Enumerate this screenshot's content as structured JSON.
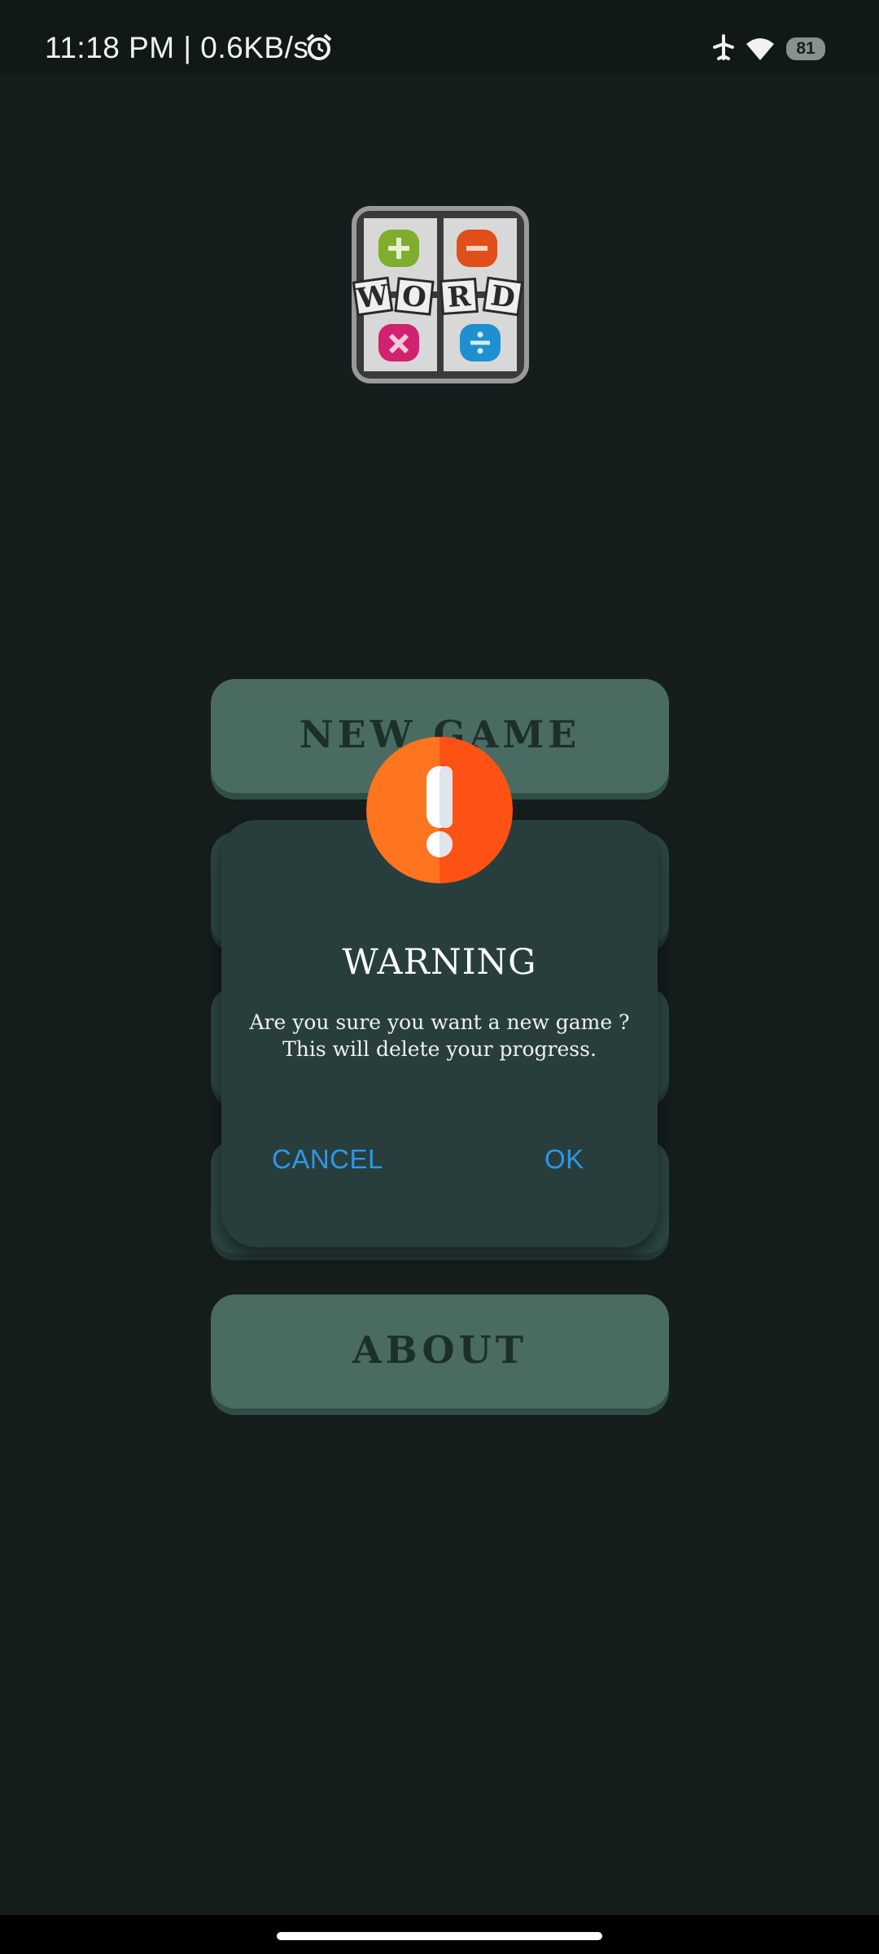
{
  "status_bar": {
    "time_speed": "11:18 PM | 0.6KB/s",
    "battery": "81"
  },
  "logo": {
    "letters": [
      "W",
      "O",
      "R",
      "D"
    ]
  },
  "menu": {
    "new_game": "NEW GAME",
    "about": "ABOUT"
  },
  "dialog": {
    "title": "WARNING",
    "message_line1": "Are you sure you want a new game ?",
    "message_line2": "This will delete your progress.",
    "cancel_label": "CANCEL",
    "ok_label": "OK"
  },
  "colors": {
    "background": "#141b1b",
    "button": "#4a6b61",
    "dialog": "#283e3d",
    "accent": "#2e97e6",
    "warning": "#ff6a1a"
  }
}
